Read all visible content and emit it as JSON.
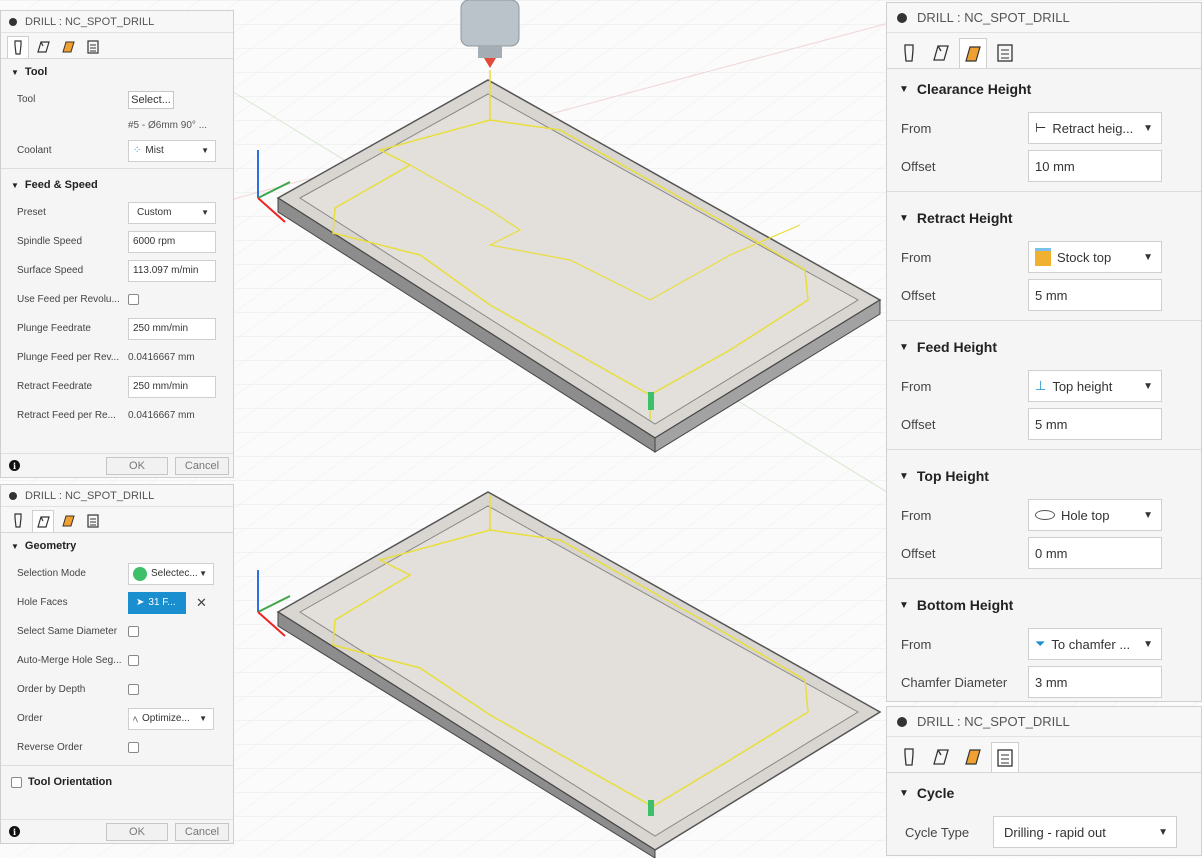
{
  "panel_title": "DRILL : NC_SPOT_DRILL",
  "tool_panel": {
    "section_tool": "Tool",
    "tool_label": "Tool",
    "tool_button": "Select...",
    "tool_desc": "#5 - Ø6mm 90° ...",
    "coolant_label": "Coolant",
    "coolant_value": "Mist",
    "section_feed": "Feed & Speed",
    "preset_label": "Preset",
    "preset_value": "Custom",
    "spindle_label": "Spindle Speed",
    "spindle_value": "6000 rpm",
    "surface_label": "Surface Speed",
    "surface_value": "113.097 m/min",
    "use_feed_label": "Use Feed per Revolu...",
    "plunge_label": "Plunge Feedrate",
    "plunge_value": "250 mm/min",
    "plunge_rev_label": "Plunge Feed per Rev...",
    "plunge_rev_value": "0.0416667 mm",
    "retract_label": "Retract Feedrate",
    "retract_value": "250 mm/min",
    "retract_rev_label": "Retract Feed per Re...",
    "retract_rev_value": "0.0416667 mm",
    "ok": "OK",
    "cancel": "Cancel"
  },
  "geometry_panel": {
    "section_geometry": "Geometry",
    "selection_mode_label": "Selection Mode",
    "selection_mode_value": "Selectec...",
    "hole_faces_label": "Hole Faces",
    "hole_faces_value": "31 F...",
    "same_diameter_label": "Select Same Diameter",
    "auto_merge_label": "Auto-Merge Hole Seg...",
    "order_depth_label": "Order by Depth",
    "order_label": "Order",
    "order_value": "Optimize...",
    "reverse_label": "Reverse Order",
    "tool_orientation_label": "Tool Orientation",
    "ok": "OK",
    "cancel": "Cancel"
  },
  "heights_panel": {
    "clearance_section": "Clearance Height",
    "clearance_from_label": "From",
    "clearance_from_value": "Retract heig...",
    "clearance_offset_label": "Offset",
    "clearance_offset_value": "10 mm",
    "retract_section": "Retract Height",
    "retract_from_label": "From",
    "retract_from_value": "Stock top",
    "retract_offset_label": "Offset",
    "retract_offset_value": "5 mm",
    "feed_section": "Feed Height",
    "feed_from_label": "From",
    "feed_from_value": "Top height",
    "feed_offset_label": "Offset",
    "feed_offset_value": "5 mm",
    "top_section": "Top Height",
    "top_from_label": "From",
    "top_from_value": "Hole top",
    "top_offset_label": "Offset",
    "top_offset_value": "0 mm",
    "bottom_section": "Bottom Height",
    "bottom_from_label": "From",
    "bottom_from_value": "To chamfer ...",
    "chamfer_label": "Chamfer Diameter",
    "chamfer_value": "3 mm"
  },
  "cycle_panel": {
    "section_cycle": "Cycle",
    "cycle_type_label": "Cycle Type",
    "cycle_type_value": "Drilling - rapid out"
  },
  "colors": {
    "accent": "#1a8fd0",
    "selection_green": "#3ec06a",
    "toolpath_yellow": "#e8de3c",
    "part_face": "#d9d6d2",
    "part_side": "#8d8d8d"
  }
}
